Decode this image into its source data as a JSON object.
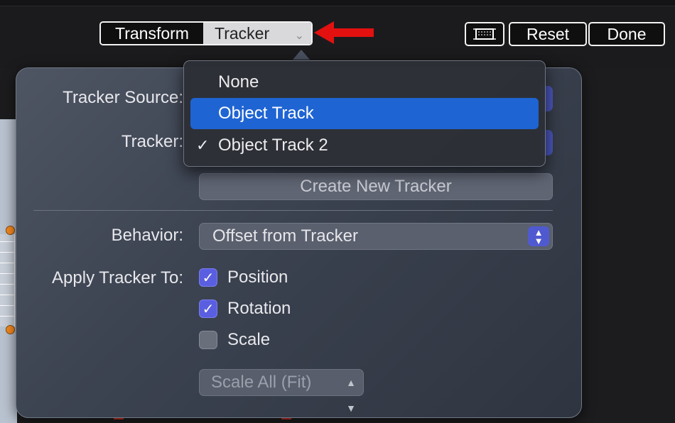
{
  "toolbar": {
    "segments": [
      "Transform",
      "Tracker"
    ],
    "selected_segment": "Tracker",
    "reset_label": "Reset",
    "done_label": "Done",
    "frame_icon": "frame-icon"
  },
  "annotation": {
    "color": "#e31010"
  },
  "inspector": {
    "tracker_source_label": "Tracker Source:",
    "tracker_label": "Tracker:",
    "create_button_label": "Create New Tracker",
    "behavior_label": "Behavior:",
    "behavior_value": "Offset from Tracker",
    "apply_label": "Apply Tracker To:",
    "checks": [
      {
        "label": "Position",
        "checked": true
      },
      {
        "label": "Rotation",
        "checked": true
      },
      {
        "label": "Scale",
        "checked": false
      }
    ],
    "scale_popup_value": "Scale All (Fit)"
  },
  "menu": {
    "items": [
      {
        "label": "None",
        "checked": false,
        "highlighted": false
      },
      {
        "label": "Object Track",
        "checked": false,
        "highlighted": true
      },
      {
        "label": "Object Track 2",
        "checked": true,
        "highlighted": false
      }
    ],
    "checkmark": "✓"
  },
  "colors": {
    "highlight": "#1f64d3",
    "checkbox_on": "#5a5ee0",
    "handle": "#f58a1f"
  }
}
